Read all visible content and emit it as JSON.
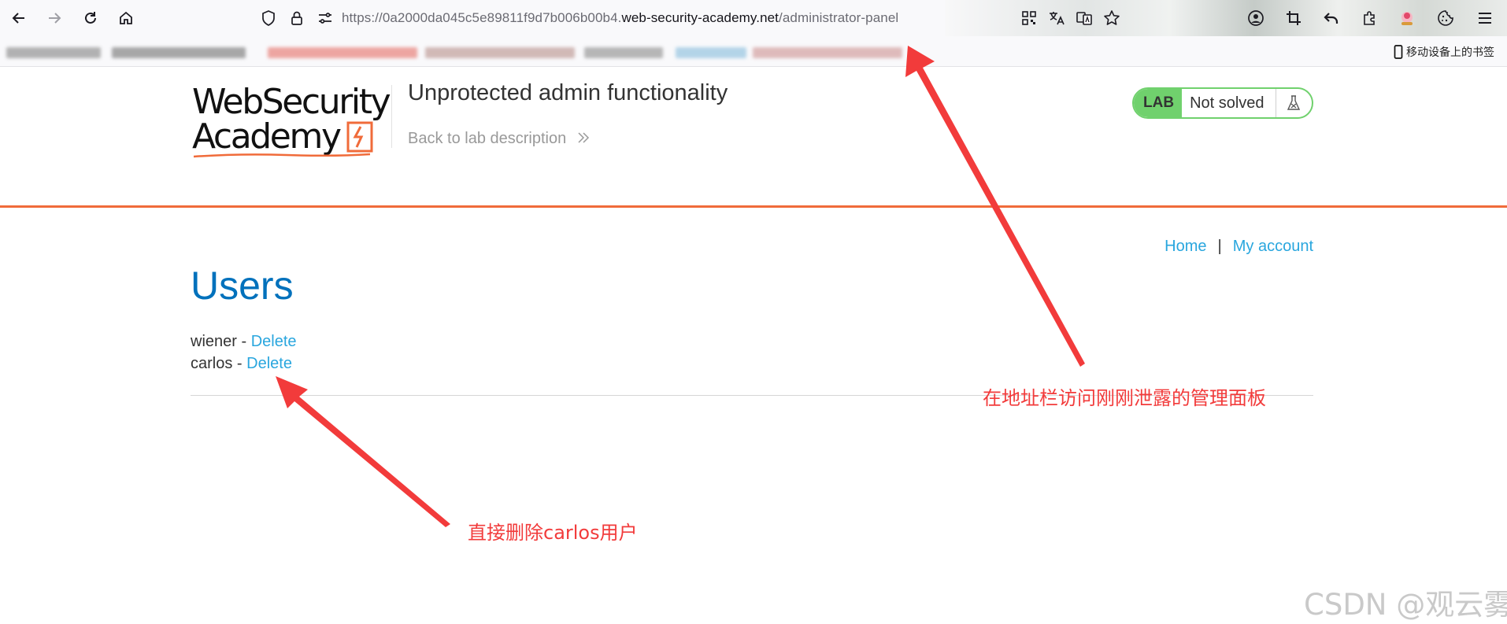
{
  "browser": {
    "url_dim_prefix": "https://0a2000da045c5e89811f9d7b006b00b4.",
    "url_domain": "web-security-academy.net",
    "url_path": "/administrator-panel",
    "mobile_bookmarks_label": "移动设备上的书签",
    "icons": [
      "back-icon",
      "forward-icon",
      "reload-icon",
      "home-icon",
      "shield-icon",
      "lock-icon",
      "permissions-icon",
      "qr-code-icon",
      "translate-icon",
      "page-translate-icon",
      "star-icon",
      "account-icon",
      "crop-icon",
      "undo-icon",
      "extensions-icon",
      "avatar-icon",
      "cookie-icon",
      "menu-icon"
    ]
  },
  "header": {
    "logo_line1": "WebSecurity",
    "logo_line2": "Academy",
    "lab_title": "Unprotected admin functionality",
    "back_link": "Back to lab description",
    "badge_lab": "LAB",
    "badge_status": "Not solved",
    "colors": {
      "accent_orange": "#f06b3a",
      "badge_green": "#70d16d",
      "link_blue": "#29a6de",
      "heading_blue": "#0071bc"
    }
  },
  "nav": {
    "home": "Home",
    "separator": "|",
    "my_account": "My account"
  },
  "main": {
    "heading": "Users",
    "users": [
      {
        "name": "wiener",
        "separator": " - ",
        "action": "Delete"
      },
      {
        "name": "carlos",
        "separator": " - ",
        "action": "Delete"
      }
    ]
  },
  "annotations": {
    "address_bar_note": "在地址栏访问刚刚泄露的管理面板",
    "delete_note": "直接删除carlos用户",
    "watermark": "CSDN @观云雾"
  }
}
